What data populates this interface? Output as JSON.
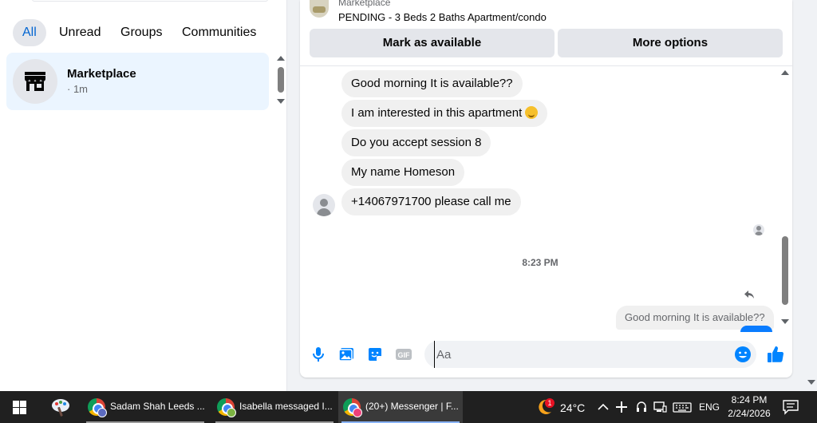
{
  "filters": {
    "all": "All",
    "unread": "Unread",
    "groups": "Groups",
    "communities": "Communities"
  },
  "conversation": {
    "name": "Marketplace",
    "time": "· 1m"
  },
  "listing": {
    "source": "Marketplace",
    "title": "PENDING - 3 Beds 2 Baths Apartment/condo",
    "mark_available": "Mark as available",
    "more_options": "More options"
  },
  "messages": [
    {
      "text": "Good morning It is available??"
    },
    {
      "text": "I am interested in this apartment"
    },
    {
      "text": "Do you accept session 8"
    },
    {
      "text": "My name Homeson"
    },
    {
      "text": "+14067971700 please call me"
    }
  ],
  "timestamp": "8:23 PM",
  "reply_preview": "Good morning It is available??",
  "composer": {
    "placeholder": "Aa"
  },
  "colors": {
    "accent": "#0084ff",
    "active_filter": "#0064d1",
    "selected_row": "#ebf5ff",
    "bubble": "#f0f0f0"
  },
  "taskbar": {
    "tasks": [
      {
        "label": "Sadam Shah Leeds ..."
      },
      {
        "label": "Isabella messaged I..."
      },
      {
        "label": "(20+) Messenger | F..."
      }
    ],
    "weather_badge": "1",
    "temperature": "24°C",
    "language": "ENG",
    "time": "8:24 PM",
    "date": "2/24/2026"
  }
}
